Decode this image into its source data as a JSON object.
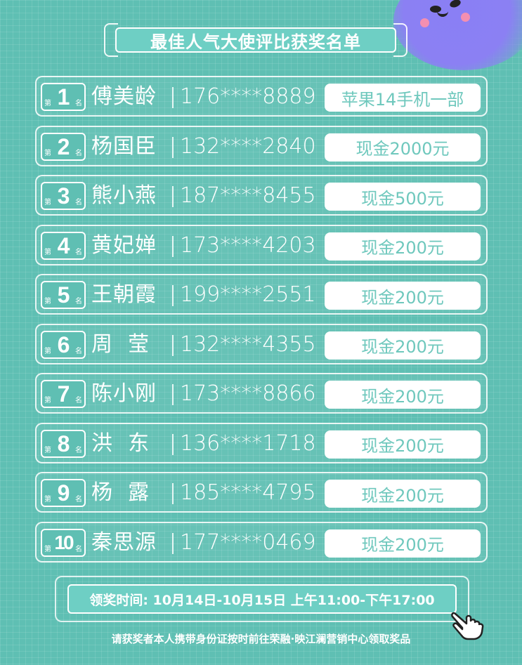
{
  "title": "最佳人气大使评比获奖名单",
  "rank_prefix": "第",
  "rank_suffix": "名",
  "winners": [
    {
      "rank": "1",
      "name": "傅美龄",
      "phone": "176****8889",
      "prize": "苹果14手机一部"
    },
    {
      "rank": "2",
      "name": "杨国臣",
      "phone": "132****2840",
      "prize": "现金2000元"
    },
    {
      "rank": "3",
      "name": "熊小燕",
      "phone": "187****8455",
      "prize": "现金500元"
    },
    {
      "rank": "4",
      "name": "黄妃婵",
      "phone": "173****4203",
      "prize": "现金200元"
    },
    {
      "rank": "5",
      "name": "王朝霞",
      "phone": "199****2551",
      "prize": "现金200元"
    },
    {
      "rank": "6",
      "name": "周  莹",
      "phone": "132****4355",
      "prize": "现金200元"
    },
    {
      "rank": "7",
      "name": "陈小刚",
      "phone": "173****8866",
      "prize": "现金200元"
    },
    {
      "rank": "8",
      "name": "洪  东",
      "phone": "136****1718",
      "prize": "现金200元"
    },
    {
      "rank": "9",
      "name": "杨  露",
      "phone": "185****4795",
      "prize": "现金200元"
    },
    {
      "rank": "10",
      "name": "秦思源",
      "phone": "177****0469",
      "prize": "现金200元"
    }
  ],
  "claim_time": "领奖时间: 10月14日-10月15日 上午11:00-下午17:00",
  "notice": "请获奖者本人携带身份证按时前往荣融·映江澜营销中心领取奖品",
  "colors": {
    "background": "#5fbfb3",
    "mascot": "#8b80f3",
    "prize_text": "#6fc8bd"
  },
  "icons": {
    "mascot": "mascot-face-icon",
    "pointer": "pointing-hand-icon"
  }
}
